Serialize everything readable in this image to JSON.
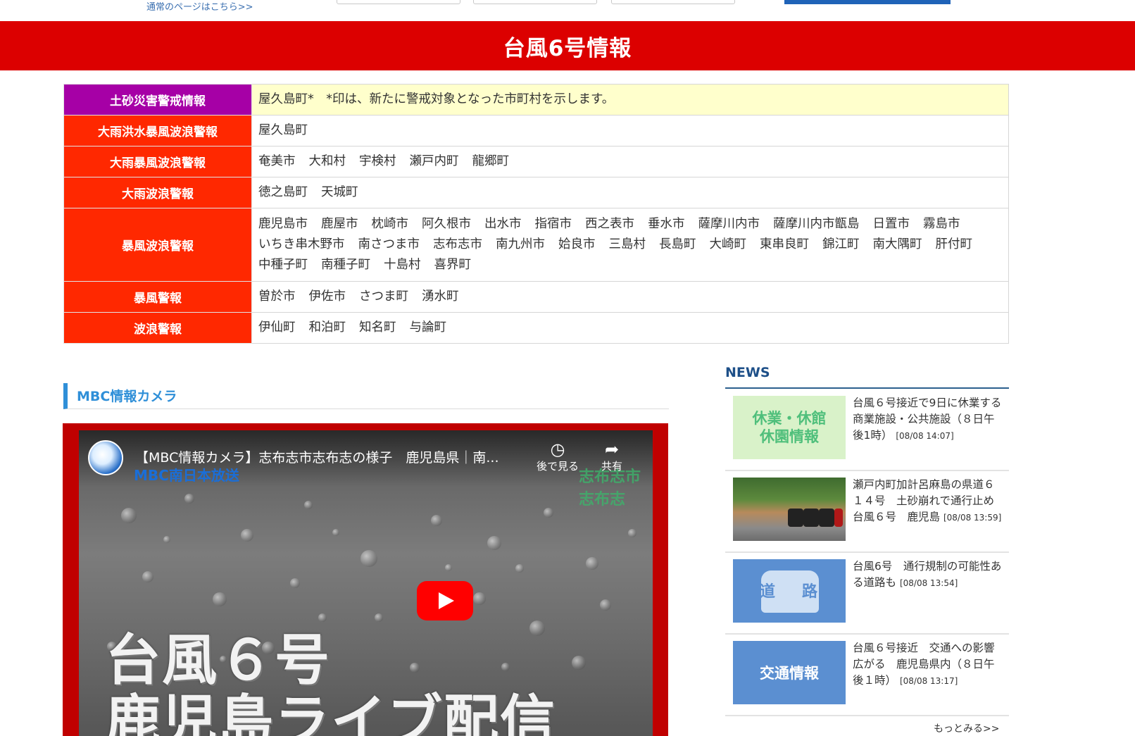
{
  "top": {
    "normal_page_link": "通常のページはこちら>>"
  },
  "banner": {
    "title": "台風6号情報"
  },
  "warnings": [
    {
      "label": "土砂災害警戒情報",
      "color": "#a600a6",
      "municipalities": [
        "屋久島町*　*印は、新たに警戒対象となった市町村を示します。"
      ]
    },
    {
      "label": "大雨洪水暴風波浪警報",
      "color": "#ff2800",
      "municipalities": [
        "屋久島町"
      ]
    },
    {
      "label": "大雨暴風波浪警報",
      "color": "#ff2800",
      "municipalities": [
        "奄美市",
        "大和村",
        "宇検村",
        "瀬戸内町",
        "龍郷町"
      ]
    },
    {
      "label": "大雨波浪警報",
      "color": "#ff2800",
      "municipalities": [
        "徳之島町",
        "天城町"
      ]
    },
    {
      "label": "暴風波浪警報",
      "color": "#ff2800",
      "municipalities": [
        "鹿児島市",
        "鹿屋市",
        "枕崎市",
        "阿久根市",
        "出水市",
        "指宿市",
        "西之表市",
        "垂水市",
        "薩摩川内市",
        "薩摩川内市甑島",
        "日置市",
        "霧島市",
        "いちき串木野市",
        "南さつま市",
        "志布志市",
        "南九州市",
        "姶良市",
        "三島村",
        "長島町",
        "大崎町",
        "東串良町",
        "錦江町",
        "南大隅町",
        "肝付町",
        "中種子町",
        "南種子町",
        "十島村",
        "喜界町"
      ]
    },
    {
      "label": "暴風警報",
      "color": "#ff2800",
      "municipalities": [
        "曽於市",
        "伊佐市",
        "さつま町",
        "湧水町"
      ]
    },
    {
      "label": "波浪警報",
      "color": "#ff2800",
      "municipalities": [
        "伊仙町",
        "和泊町",
        "知名町",
        "与論町"
      ]
    }
  ],
  "camera": {
    "heading": "MBC情報カメラ",
    "video_title": "【MBC情報カメラ】志布志市志布志の様子　鹿児島県｜南...",
    "channel_mark": "MBC南日本放送",
    "location_mark": "志布志市志布志",
    "watch_later": "後で見る",
    "share": "共有",
    "overlay_line1": "台風６号",
    "overlay_line2": "鹿児島ライブ配信"
  },
  "news": {
    "heading": "NEWS",
    "items": [
      {
        "thumb": "休業・休館休園情報",
        "thumb_line1": "休業・休館",
        "thumb_line2": "休園情報",
        "text": "台風６号接近で9日に休業する商業施設・公共施設（８日午後1時）",
        "date": "[08/08 14:07]"
      },
      {
        "thumb": "photo",
        "text": "瀬戸内町加計呂麻島の県道６１４号　土砂崩れで通行止め　台風６号　鹿児島",
        "date": "[08/08 13:59]"
      },
      {
        "thumb": "道路",
        "thumb_l": "道",
        "thumb_r": "路",
        "text": "台風6号　通行規制の可能性ある道路も",
        "date": "[08/08 13:54]"
      },
      {
        "thumb": "交通情報",
        "text": "台風６号接近　交通への影響広がる　鹿児島県内（８日午後１時）",
        "date": "[08/08 13:17]"
      }
    ],
    "more": "もっとみる>>"
  }
}
